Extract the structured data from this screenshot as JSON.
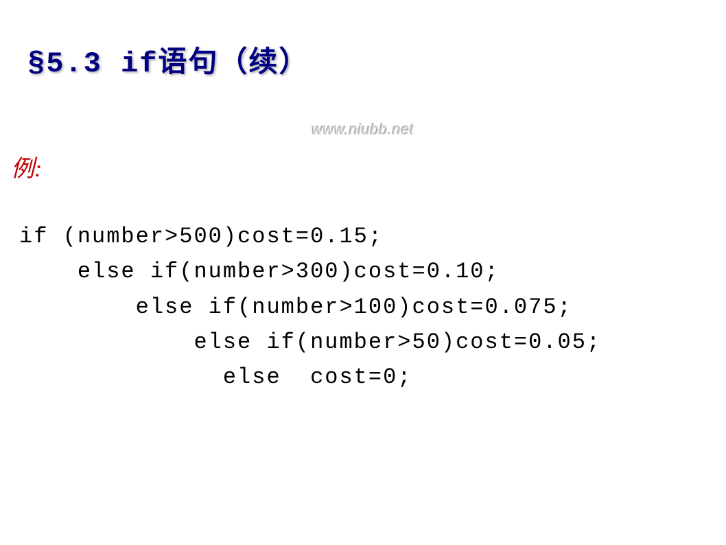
{
  "heading": "§5.3 if语句（续）",
  "watermark": "www.niubb.net",
  "example_label": "例:",
  "code": {
    "line1": "if (number>500)cost=0.15;",
    "line2": "    else if(number>300)cost=0.10;",
    "line3": "        else if(number>100)cost=0.075;",
    "line4": "            else if(number>50)cost=0.05;",
    "line5": "              else  cost=0;"
  }
}
